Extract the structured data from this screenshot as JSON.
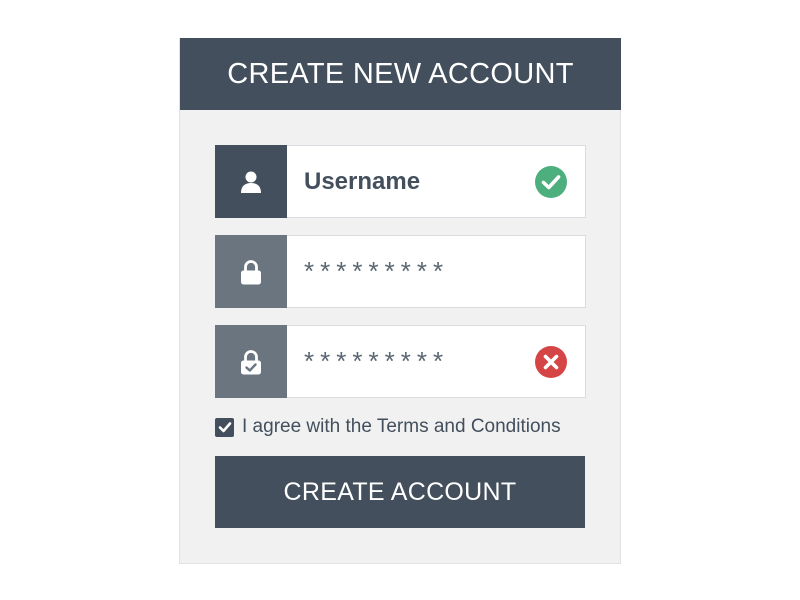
{
  "form": {
    "title": "CREATE NEW ACCOUNT",
    "username": {
      "value": "Username",
      "leading_icon": "user-icon",
      "status": "valid",
      "status_icon": "check-circle-icon",
      "status_color": "#4caf7d"
    },
    "password": {
      "value": "*********",
      "leading_icon": "lock-icon"
    },
    "confirm_password": {
      "value": "*********",
      "leading_icon": "lock-check-icon",
      "status": "invalid",
      "status_icon": "x-circle-icon",
      "status_color": "#d64545"
    },
    "terms": {
      "checked": true,
      "label": "I agree with the Terms and Conditions"
    },
    "submit_label": "CREATE ACCOUNT"
  },
  "colors": {
    "primary": "#434f5c",
    "secondary_icon_bg": "#6a7580",
    "panel_bg": "#f1f1f1",
    "success": "#4caf7d",
    "error": "#d64545"
  }
}
